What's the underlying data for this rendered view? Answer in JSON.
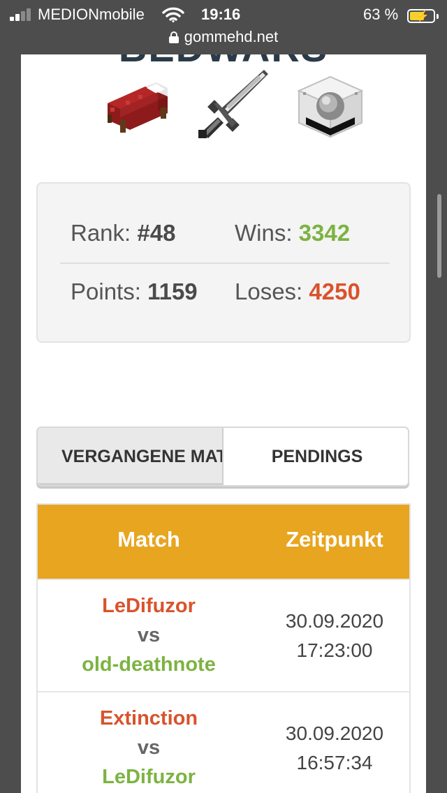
{
  "status_bar": {
    "carrier": "MEDIONmobile",
    "time": "19:16",
    "battery_percent": "63 %",
    "url": "gommehd.net",
    "signal_bars": 4,
    "signal_bars_active": 2
  },
  "page": {
    "heading_partial": "BEDWARS"
  },
  "icons": {
    "bed": "bed-icon",
    "sword": "sword-icon",
    "block": "glass-block-icon"
  },
  "stats": {
    "rank_label": "Rank:",
    "rank_value": "#48",
    "wins_label": "Wins:",
    "wins_value": "3342",
    "points_label": "Points:",
    "points_value": "1159",
    "loses_label": "Loses:",
    "loses_value": "4250"
  },
  "tabs": [
    {
      "label": "VERGANGENE MATCHES",
      "active": true
    },
    {
      "label": "PENDINGS",
      "active": false
    }
  ],
  "table": {
    "headers": {
      "match": "Match",
      "time": "Zeitpunkt"
    },
    "rows": [
      {
        "player1": "LeDifuzor",
        "vs": "vs",
        "player2": "old-deathnote",
        "date": "30.09.2020",
        "time": "17:23:00"
      },
      {
        "player1": "Extinction",
        "vs": "vs",
        "player2": "LeDifuzor",
        "date": "30.09.2020",
        "time": "16:57:34"
      }
    ]
  },
  "colors": {
    "header_accent": "#e8a520",
    "loser_red": "#d9532c",
    "winner_green": "#7cb342"
  }
}
